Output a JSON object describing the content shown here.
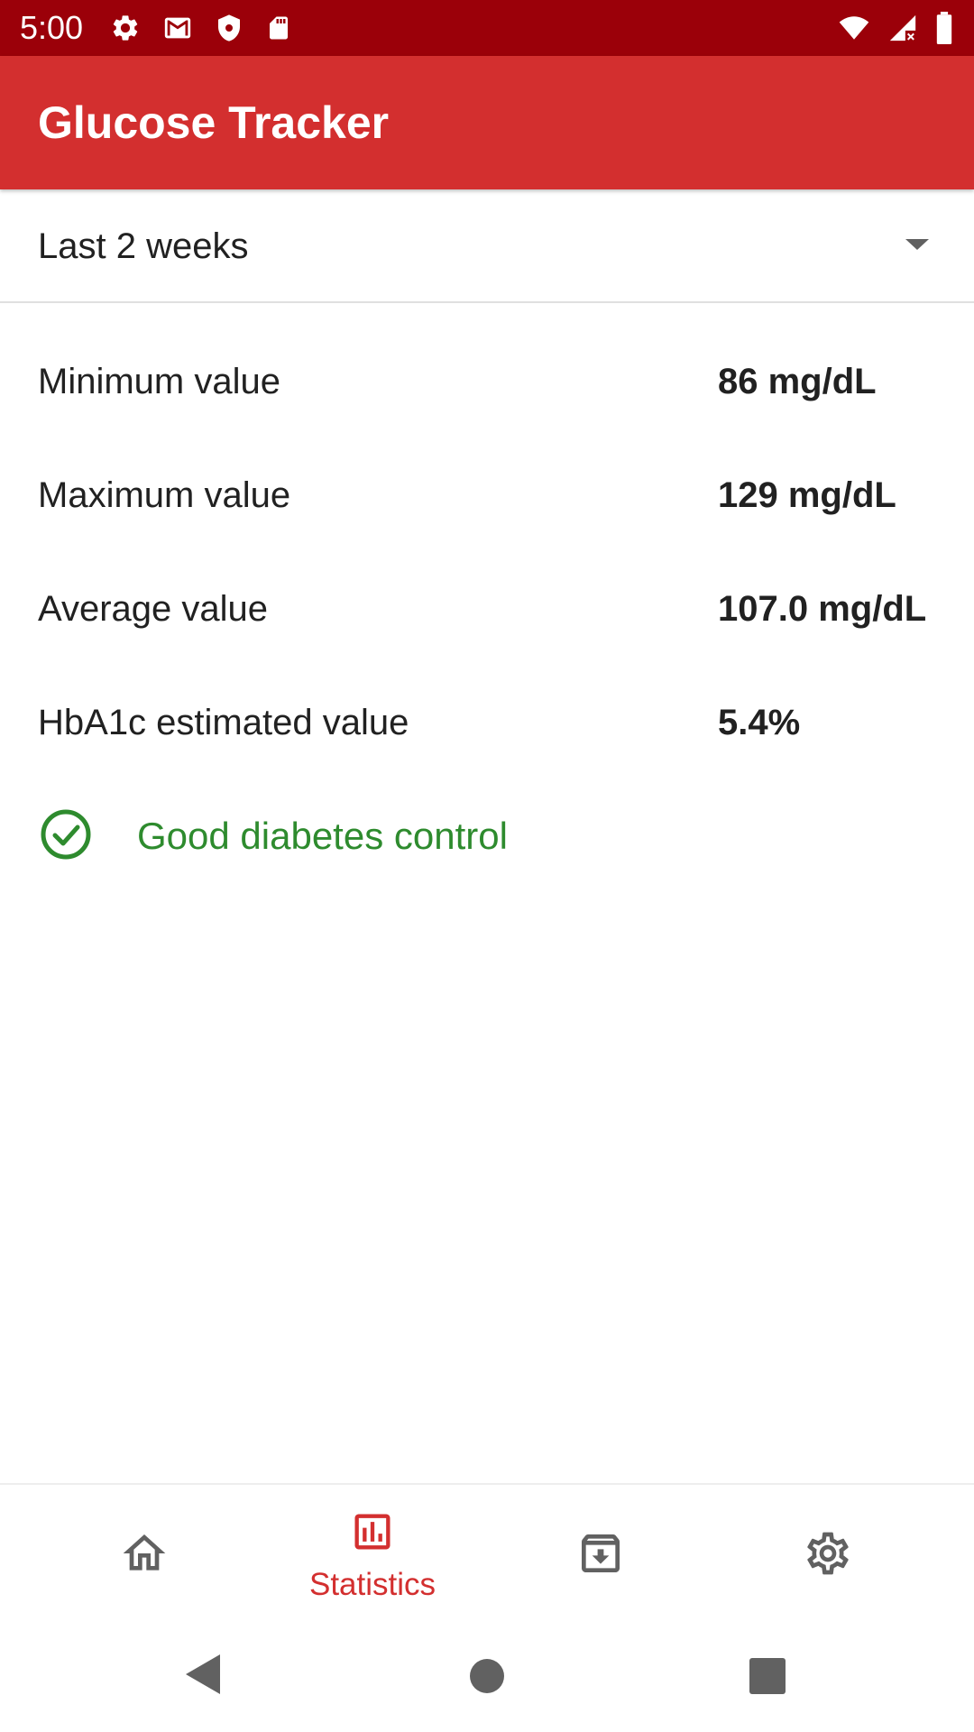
{
  "status_bar": {
    "time": "5:00",
    "left_icons": [
      "gear-icon",
      "mail-icon",
      "shield-icon",
      "sd-card-icon"
    ],
    "right_icons": [
      "wifi-icon",
      "signal-icon",
      "battery-icon"
    ]
  },
  "app_bar": {
    "title": "Glucose Tracker"
  },
  "period_selector": {
    "selected": "Last 2 weeks"
  },
  "stats": [
    {
      "label": "Minimum value",
      "value": "86 mg/dL"
    },
    {
      "label": "Maximum value",
      "value": "129 mg/dL"
    },
    {
      "label": "Average value",
      "value": "107.0 mg/dL"
    },
    {
      "label": "HbA1c estimated value",
      "value": "5.4%"
    }
  ],
  "control_status": {
    "text": "Good diabetes control",
    "icon": "check-circle-icon"
  },
  "bottom_nav": {
    "items": [
      {
        "id": "home",
        "icon": "home-icon",
        "label": ""
      },
      {
        "id": "statistics",
        "icon": "chart-icon",
        "label": "Statistics",
        "active": true
      },
      {
        "id": "archive",
        "icon": "archive-download-icon",
        "label": ""
      },
      {
        "id": "settings",
        "icon": "settings-icon",
        "label": ""
      }
    ]
  },
  "colors": {
    "status_bar": "#9b0009",
    "app_bar": "#d32f2f",
    "accent": "#d32f2f",
    "success": "#2e8b2e",
    "inactive_icon": "#616161"
  }
}
